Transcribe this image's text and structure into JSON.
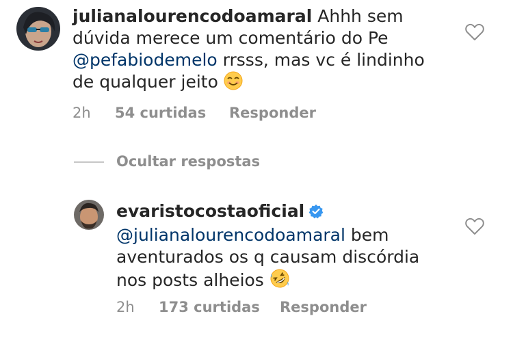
{
  "comment1": {
    "username": "julianalourencodoamaral",
    "text_part1": "Ahhh sem",
    "text_line2": "dúvida merece um comentário do Pe",
    "mention": "@pefabiodemelo",
    "text_part3": " rrsss, mas vc é lindinho",
    "text_line4": "de qualquer jeito",
    "emoji": "smiling-face-icon",
    "time": "2h",
    "likes": "54 curtidas",
    "reply_label": "Responder"
  },
  "replies_toggle": {
    "label": "Ocultar respostas"
  },
  "comment2": {
    "username": "evaristocostaoficial",
    "verified": true,
    "mention": "@julianalourencodoamaral",
    "text_part1": " bem",
    "text_line2": "aventurados os q causam discórdia",
    "text_line3": "nos posts alheios",
    "emoji": "rolling-laughing-face-icon",
    "time": "2h",
    "likes": "173 curtidas",
    "reply_label": "Responder"
  },
  "colors": {
    "mention": "#003569",
    "meta": "#8e8e8e",
    "verified": "#3897f0"
  }
}
